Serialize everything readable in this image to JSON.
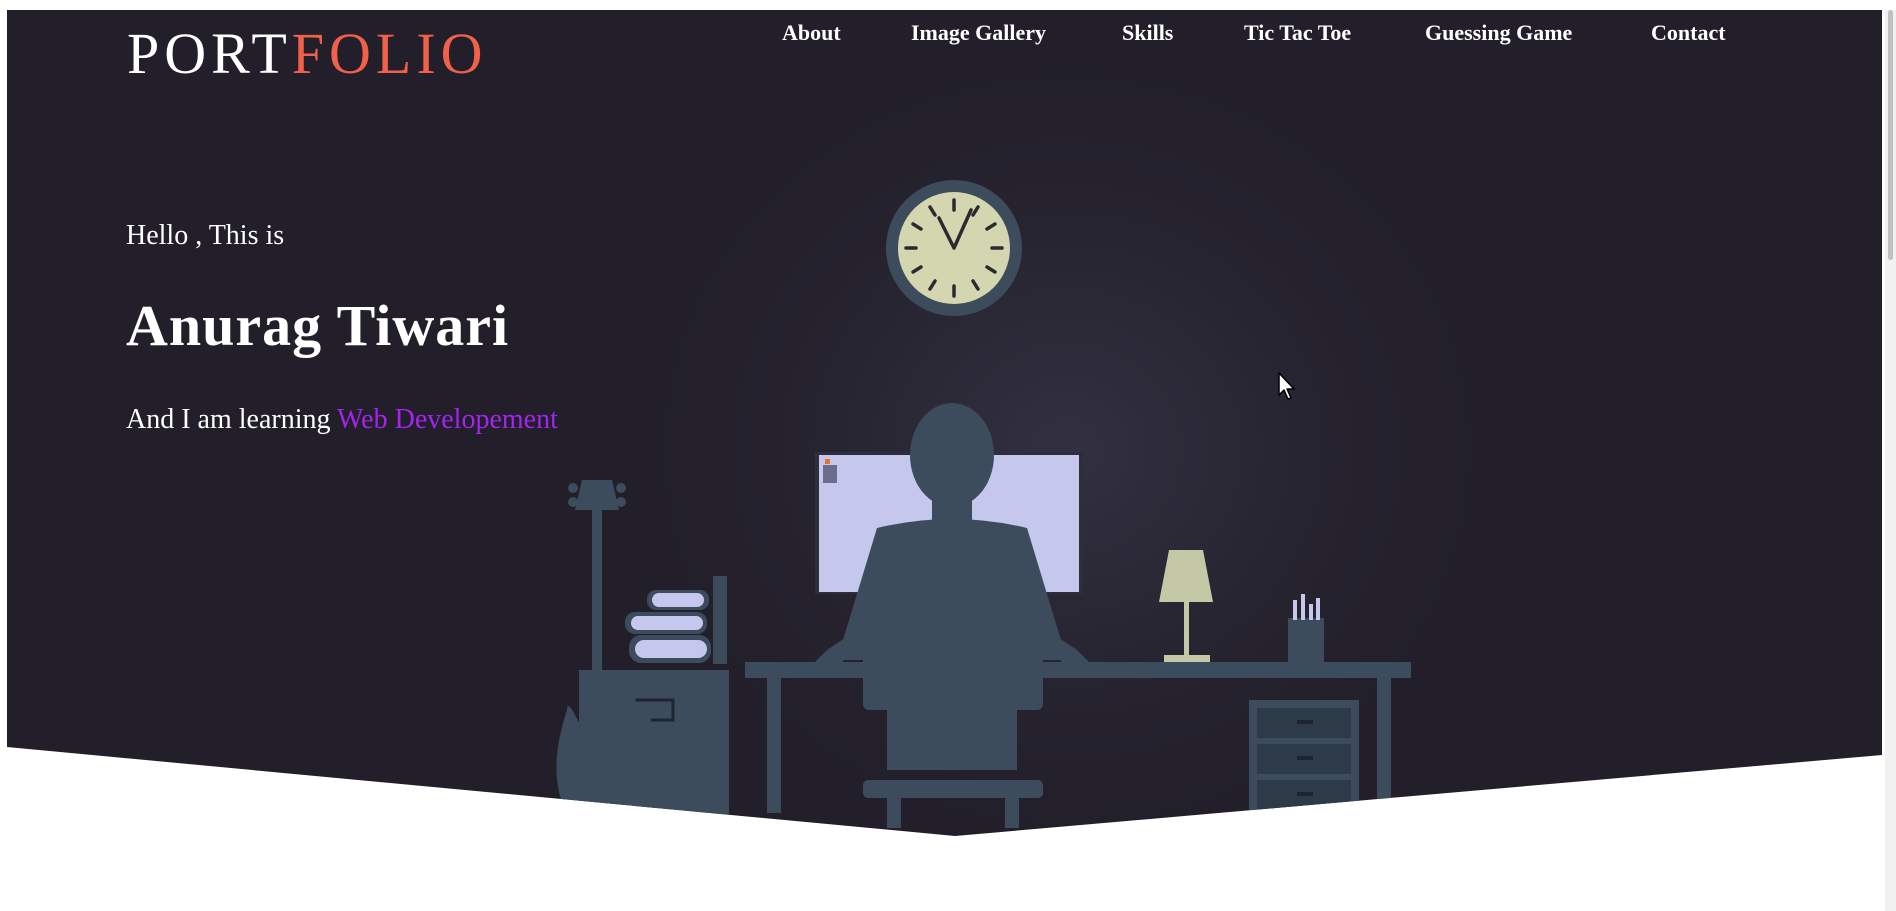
{
  "logo": {
    "part1": "PORT",
    "part2": "FOLIO"
  },
  "nav": {
    "about": "About",
    "gallery": "Image Gallery",
    "skills": "Skills",
    "tictactoe": "Tic Tac Toe",
    "guessing": "Guessing Game",
    "contact": "Contact"
  },
  "hero": {
    "greeting": "Hello , This is",
    "name": "Anurag Tiwari",
    "learning_prefix": "And I am learning ",
    "learning_highlight": "Web Developement"
  },
  "colors": {
    "hero_bg": "#221f2a",
    "logo_accent": "#f0604a",
    "highlight": "#a522f0",
    "illustration": "#3c4c5c"
  },
  "illustration": {
    "icons": [
      "clock-icon",
      "guitar-icon",
      "books-icon",
      "monitor-icon",
      "person-silhouette-icon",
      "lamp-icon",
      "pencil-cup-icon",
      "desk-icon",
      "chair-icon"
    ]
  }
}
